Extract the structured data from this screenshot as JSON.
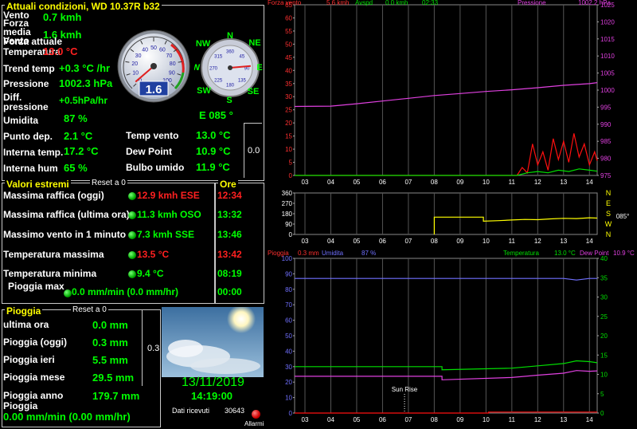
{
  "current": {
    "title": "Attuali condizioni, WD 10.37R b32",
    "vento_label": "Vento",
    "vento_value": "0.7 kmh",
    "forza_media_label": "Forza media Vento",
    "forza_media_value": "1.6 kmh",
    "forza_attuale_label": "Forza attuale",
    "temperatura_label": "Temperatura",
    "temperatura_value": "13.0 °C",
    "trend_label": "Trend temp",
    "trend_value": "+0.3 °C /hr",
    "pressione_label": "Pressione",
    "pressione_value": "1002.3 hPa",
    "diff_label": "Diff. pressione",
    "diff_value": "+0.5hPa/hr",
    "umidita_label": "Umidita",
    "umidita_value": "87 %",
    "direction_value": "E  085 °",
    "punto_label": "Punto dep.",
    "punto_value": "2.1 °C",
    "temp_vento_label": "Temp vento",
    "temp_vento_value": "13.0 °C",
    "interna_temp_label": "Interna temp.",
    "interna_temp_value": "17.2 °C",
    "dew_label": "Dew Point",
    "dew_value": "10.9 °C",
    "interna_hum_label": "Interna hum",
    "interna_hum_value": "65 %",
    "bulbo_label": "Bulbo umido",
    "bulbo_value": "11.9 °C",
    "side_box_value": "0.0",
    "speed_gauge": {
      "value_text": "1.6",
      "value": 1.6,
      "max": 100,
      "ticks": [
        "0",
        "10",
        "20",
        "30",
        "40",
        "50",
        "60",
        "70",
        "80",
        "90",
        "100"
      ]
    },
    "compass": {
      "direction_deg": 85,
      "labels": {
        "N": "N",
        "NE": "NE",
        "E": "E",
        "SE": "SE",
        "S": "S",
        "SW": "SW",
        "W": "W",
        "NW": "NW"
      },
      "degree_ticks": [
        "45",
        "90",
        "135",
        "180",
        "225",
        "270",
        "315",
        "360"
      ]
    }
  },
  "extremes": {
    "title": "Valori estremi",
    "reset": "Reset a 0",
    "ore_title": "Ore",
    "rows": [
      {
        "label": "Massima raffica (oggi)",
        "value": "12.9 kmh ESE",
        "time": "12:34",
        "value_red": true,
        "time_red": true
      },
      {
        "label": "Massima raffica (ultima ora)",
        "value": "11.3 kmh OSO",
        "time": "13:32",
        "value_red": false,
        "time_red": false
      },
      {
        "label": "Massimo vento in 1 minuto",
        "value": "7.3 kmh SSE",
        "time": "13:46",
        "value_red": false,
        "time_red": false
      },
      {
        "label": "Temperatura massima",
        "value": "13.5 °C",
        "time": "13:42",
        "value_red": true,
        "time_red": true
      },
      {
        "label": "Temperatura minima",
        "value": "9.4 °C",
        "time": "08:19",
        "value_red": false,
        "time_red": false
      },
      {
        "label": "Pioggia max",
        "value": "0.0 mm/min (0.0 mm/hr)",
        "time": "00:00",
        "value_red": false,
        "time_red": false
      }
    ]
  },
  "rain": {
    "title": "Pioggia",
    "reset": "Reset a 0",
    "rows": [
      {
        "label": "ultima ora",
        "value": "0.0 mm"
      },
      {
        "label": "Pioggia (oggi)",
        "value": "0.3 mm"
      },
      {
        "label": "Pioggia ieri",
        "value": "5.5 mm"
      },
      {
        "label": "Pioggia mese",
        "value": "29.5 mm"
      },
      {
        "label": "Pioggia anno",
        "value": "179.7 mm"
      }
    ],
    "rate_label": "Pioggia",
    "rate_value": "0.00 mm/min (0.00 mm/hr)",
    "side_value": "0.3"
  },
  "status": {
    "date": "13/11/2019",
    "time": "14:19:00",
    "dati_label": "Dati ricevuti",
    "dati_value": "30643",
    "allarmi_label": "Allarmi"
  },
  "chart_data": [
    {
      "type": "line",
      "legend": {
        "forza": "Forza vento",
        "forza_value": "5.6 kmh",
        "avspd": "Avspd",
        "avspd_value": "0.0 kmh",
        "time": "02:33",
        "pressione": "Pressione",
        "pressione_value": "1002.2 hPa"
      },
      "categories": [
        "03",
        "04",
        "05",
        "06",
        "07",
        "08",
        "09",
        "10",
        "11",
        "12",
        "13",
        "14"
      ],
      "y_left_ticks": [
        "0",
        "5",
        "10",
        "15",
        "20",
        "25",
        "30",
        "35",
        "40",
        "45",
        "50",
        "55",
        "60",
        "65"
      ],
      "y_right_ticks": [
        "975",
        "980",
        "985",
        "990",
        "995",
        "1000",
        "1005",
        "1010",
        "1015",
        "1020",
        "1025"
      ],
      "ylim_left": [
        0,
        65
      ],
      "ylim_right": [
        975,
        1025
      ],
      "series": [
        {
          "name": "Pressione",
          "axis": "right",
          "color": "#e040e0",
          "x": [
            2.6,
            4,
            5,
            6,
            7,
            8,
            9,
            10,
            11,
            12,
            13,
            14,
            14.3
          ],
          "values": [
            995.2,
            995.3,
            996,
            996.8,
            997.6,
            998.4,
            999,
            999.6,
            1000.1,
            1000.7,
            1001.4,
            1001.9,
            1002.2
          ]
        },
        {
          "name": "Forza vento",
          "axis": "left",
          "color": "#ff1010",
          "x": [
            2.6,
            11.2,
            11.4,
            11.6,
            11.8,
            12.0,
            12.2,
            12.4,
            12.6,
            12.8,
            13.0,
            13.2,
            13.4,
            13.6,
            13.8,
            14.0,
            14.2,
            14.3
          ],
          "values": [
            0,
            0,
            3,
            1,
            12,
            4,
            9,
            2,
            14,
            6,
            13,
            5,
            16,
            7,
            12,
            4,
            9,
            5.6
          ]
        },
        {
          "name": "Avspd",
          "axis": "left",
          "color": "#00e000",
          "x": [
            2.6,
            11.2,
            11.6,
            12.0,
            12.4,
            12.8,
            13.2,
            13.6,
            14.0,
            14.3
          ],
          "values": [
            0,
            0,
            1,
            1.5,
            1,
            2,
            1.5,
            2.5,
            2,
            1.6
          ]
        }
      ]
    },
    {
      "type": "line",
      "categories": [
        "03",
        "04",
        "05",
        "06",
        "07",
        "08",
        "09",
        "10",
        "11",
        "12",
        "13",
        "14"
      ],
      "y_ticks": [
        "0",
        "90",
        "180",
        "270",
        "360"
      ],
      "y_right_labels": [
        "N",
        "W",
        "S",
        "E",
        "N"
      ],
      "right_value": "085°",
      "ylim": [
        0,
        360
      ],
      "series": [
        {
          "name": "direction",
          "color": "#ffff00",
          "x": [
            8.0,
            8.0,
            9.9,
            9.9,
            10.5,
            11,
            11.5,
            12,
            12.5,
            13,
            13.5,
            14,
            14.3
          ],
          "values": [
            0,
            150,
            150,
            115,
            120,
            125,
            130,
            128,
            135,
            140,
            138,
            145,
            142
          ]
        }
      ]
    },
    {
      "type": "line",
      "legend": {
        "pioggia": "Pioggia",
        "pioggia_value": "0.3 mm",
        "umidita": "Umidita",
        "umidita_value": "87 %",
        "temperatura": "Temperatura",
        "temperatura_value": "13.0 °C",
        "dew": "Dew Point",
        "dew_value": "10.9 °C",
        "sunrise": "Sun Rise"
      },
      "categories": [
        "03",
        "04",
        "05",
        "06",
        "07",
        "08",
        "09",
        "10",
        "11",
        "12",
        "13",
        "14"
      ],
      "y_left_ticks": [
        "0",
        "10",
        "20",
        "30",
        "40",
        "50",
        "60",
        "70",
        "80",
        "90",
        "100"
      ],
      "y_right_ticks": [
        "0",
        "5",
        "10",
        "15",
        "20",
        "25",
        "30",
        "35",
        "40"
      ],
      "ylim_left": [
        0,
        100
      ],
      "ylim_right": [
        0,
        40
      ],
      "sunrise_x": 6.85,
      "series": [
        {
          "name": "Umidita",
          "axis": "left",
          "color": "#7070ff",
          "x": [
            2.6,
            13.0,
            13.5,
            14.0,
            14.3
          ],
          "values": [
            87,
            87,
            86,
            87,
            87
          ]
        },
        {
          "name": "Temperatura",
          "axis": "right",
          "color": "#00e000",
          "x": [
            2.6,
            8.3,
            8.3,
            11,
            12,
            13,
            13.5,
            14,
            14.3
          ],
          "values": [
            12,
            12,
            11.2,
            11.6,
            12.2,
            12.8,
            13.5,
            13.3,
            13.0
          ]
        },
        {
          "name": "Dew Point",
          "axis": "right",
          "color": "#e040e0",
          "x": [
            2.6,
            8.3,
            8.3,
            11,
            12,
            13,
            13.5,
            14,
            14.3
          ],
          "values": [
            9.5,
            9.5,
            8.6,
            9.2,
            9.8,
            10.3,
            11,
            10.8,
            10.9
          ]
        },
        {
          "name": "Pioggia",
          "axis": "left",
          "color": "#ff1010",
          "x": [
            2.6,
            10.1,
            10.1,
            14.3
          ],
          "values": [
            0,
            0,
            0.6,
            0.6
          ]
        }
      ]
    }
  ]
}
